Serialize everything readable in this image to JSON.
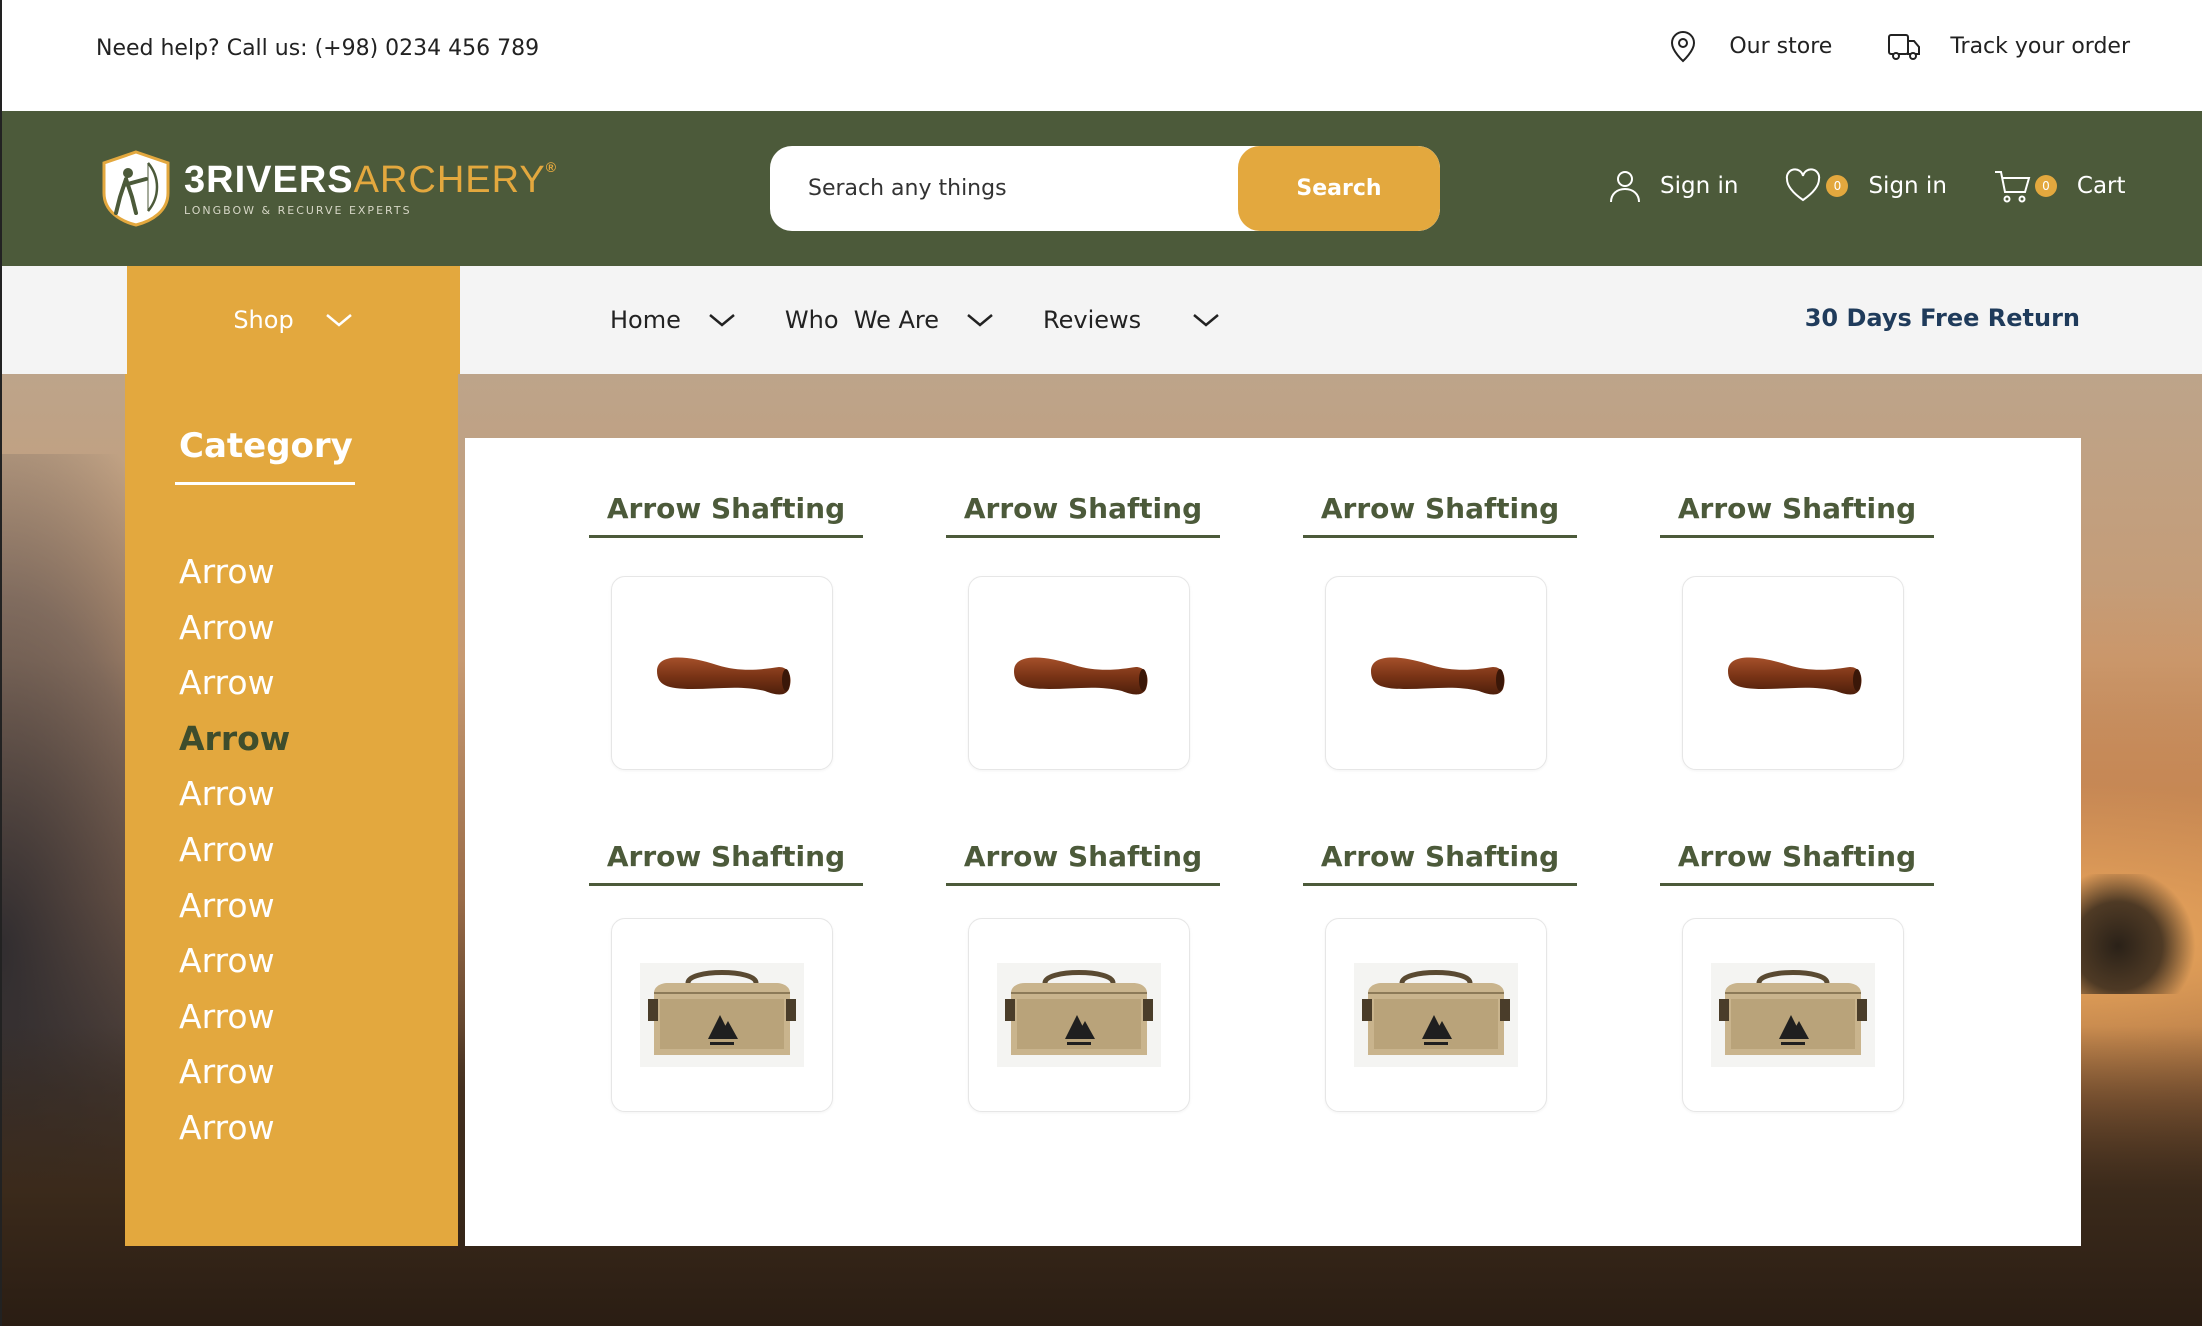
{
  "topbar": {
    "help_text": "Need help? Call us: (+98) 0234 456 789",
    "store_label": "Our store",
    "track_label": "Track your order"
  },
  "header": {
    "logo_main": "3RIVERS",
    "logo_accent": "ARCHERY",
    "logo_trademark": "®",
    "logo_tagline": "LONGBOW & RECURVE EXPERTS",
    "search_placeholder": "Serach any things",
    "search_button": "Search",
    "signin_label": "Sign in",
    "wishlist_label": "Sign in",
    "wishlist_count": "0",
    "cart_label": "Cart",
    "cart_count": "0"
  },
  "nav": {
    "shop_label": "Shop",
    "items": [
      {
        "label": "Home"
      },
      {
        "label": "Who  We Are"
      },
      {
        "label": "Reviews"
      }
    ],
    "promo": "30 Days Free Return"
  },
  "sidebar": {
    "title": "Category",
    "items": [
      {
        "label": "Arrow"
      },
      {
        "label": "Arrow"
      },
      {
        "label": "Arrow"
      },
      {
        "label": "Arrow",
        "active": true
      },
      {
        "label": "Arrow"
      },
      {
        "label": "Arrow"
      },
      {
        "label": "Arrow"
      },
      {
        "label": "Arrow"
      },
      {
        "label": "Arrow"
      },
      {
        "label": "Arrow"
      },
      {
        "label": "Arrow"
      }
    ]
  },
  "products": [
    {
      "title": "Arrow Shafting",
      "image": "wooden-grip-icon"
    },
    {
      "title": "Arrow Shafting",
      "image": "wooden-grip-icon"
    },
    {
      "title": "Arrow Shafting",
      "image": "wooden-grip-icon"
    },
    {
      "title": "Arrow Shafting",
      "image": "wooden-grip-icon"
    },
    {
      "title": "Arrow Shafting",
      "image": "gear-bag-icon"
    },
    {
      "title": "Arrow Shafting",
      "image": "gear-bag-icon"
    },
    {
      "title": "Arrow Shafting",
      "image": "gear-bag-icon"
    },
    {
      "title": "Arrow Shafting",
      "image": "gear-bag-icon"
    }
  ],
  "colors": {
    "brand_green": "#4c5a3a",
    "accent_gold": "#e3a83e",
    "promo_blue": "#1f3b5b"
  }
}
